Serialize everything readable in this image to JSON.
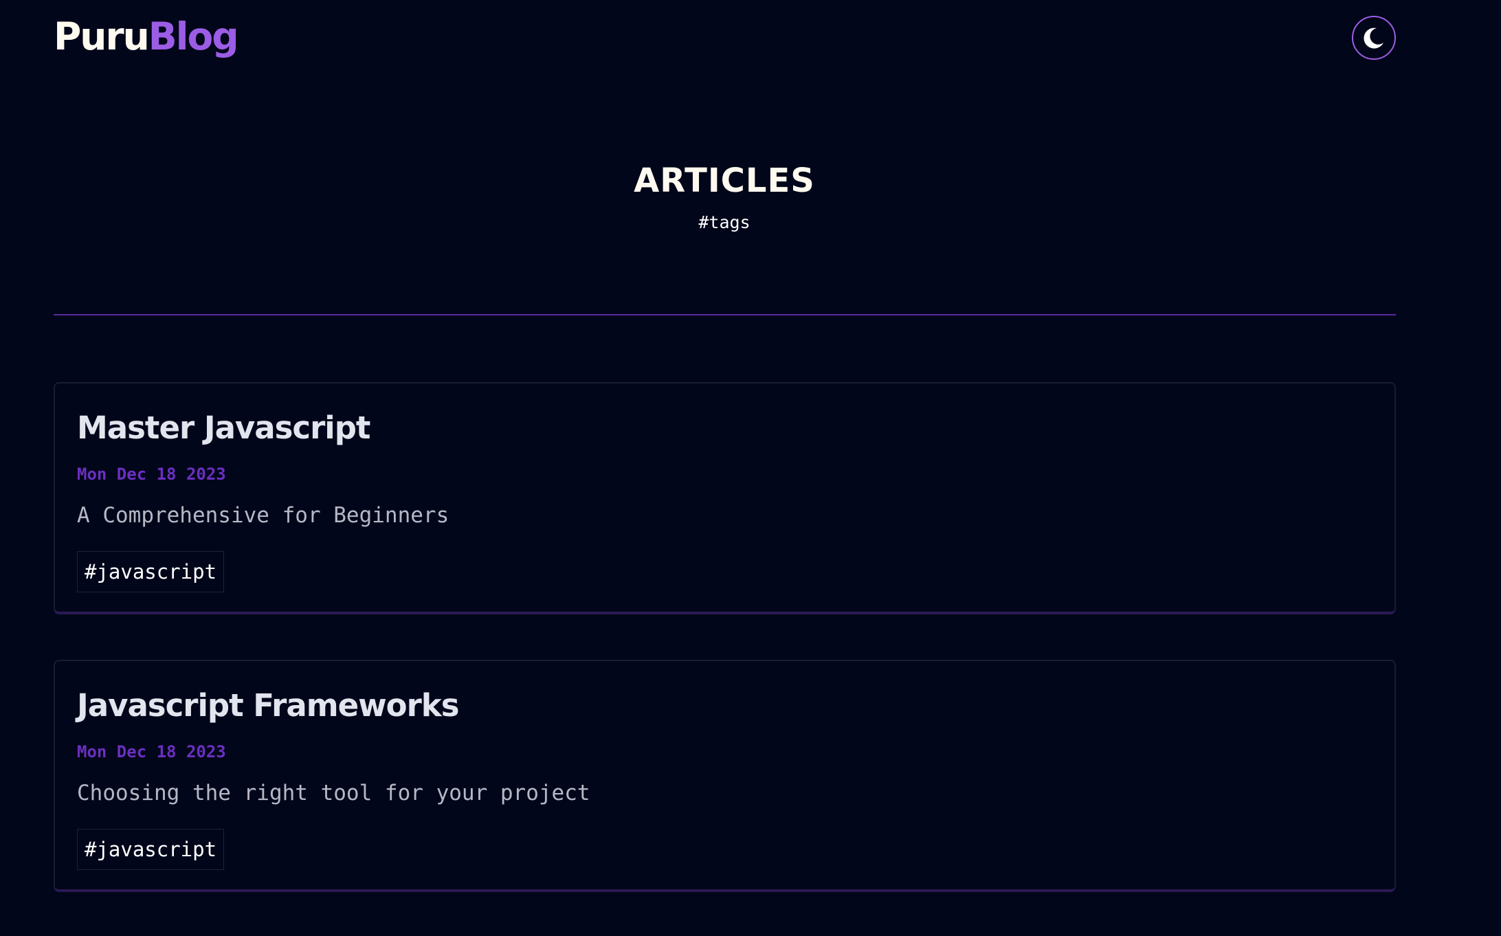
{
  "header": {
    "logo_part1": "Puru",
    "logo_part2": "Blog",
    "theme_toggle_icon": "moon-icon"
  },
  "hero": {
    "title": "ARTICLES",
    "tags_link": "#tags"
  },
  "articles": [
    {
      "title": "Master Javascript",
      "date": "Mon Dec 18 2023",
      "description": "A Comprehensive for Beginners",
      "tags": [
        "#javascript"
      ]
    },
    {
      "title": "Javascript Frameworks",
      "date": "Mon Dec 18 2023",
      "description": "Choosing the right tool for your project",
      "tags": [
        "#javascript"
      ]
    }
  ],
  "colors": {
    "background": "#02061a",
    "accent": "#9b5de5",
    "date": "#6b2fc0",
    "title": "#e2e4ee"
  }
}
